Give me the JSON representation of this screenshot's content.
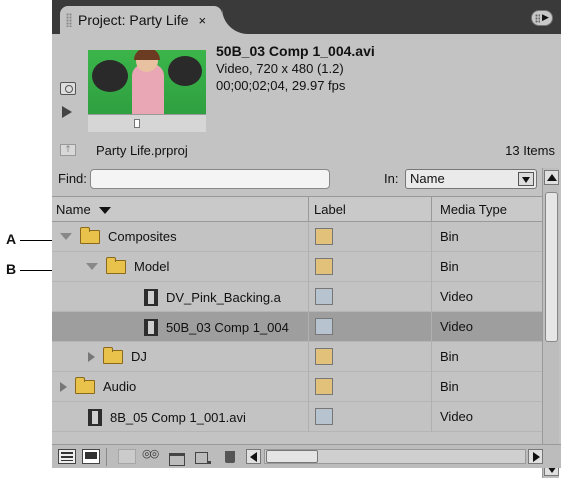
{
  "callouts": {
    "a": "A",
    "b": "B"
  },
  "tab": {
    "title": "Project: Party Life",
    "close": "×"
  },
  "preview": {
    "clip_name": "50B_03 Comp 1_004.avi",
    "info_line1": "Video, 720 x 480 (1.2)",
    "info_line2": "00;00;02;04, 29.97 fps"
  },
  "project": {
    "file": "Party Life.prproj",
    "item_count": "13 Items"
  },
  "find": {
    "label": "Find:",
    "value": "",
    "in_label": "In:",
    "in_value": "Name"
  },
  "columns": {
    "name": "Name",
    "label": "Label",
    "media_type": "Media Type"
  },
  "rows": [
    {
      "name": "Composites",
      "type": "Bin",
      "label_color": "#e2c27a"
    },
    {
      "name": "Model",
      "type": "Bin",
      "label_color": "#e2c27a"
    },
    {
      "name": "DV_Pink_Backing.a",
      "type": "Video",
      "label_color": "#b7c4d0"
    },
    {
      "name": "50B_03 Comp 1_004",
      "type": "Video",
      "label_color": "#b7c4d0"
    },
    {
      "name": "DJ",
      "type": "Bin",
      "label_color": "#e2c27a"
    },
    {
      "name": "Audio",
      "type": "Bin",
      "label_color": "#e2c27a"
    },
    {
      "name": "8B_05 Comp 1_001.avi",
      "type": "Video",
      "label_color": "#b7c4d0"
    }
  ]
}
